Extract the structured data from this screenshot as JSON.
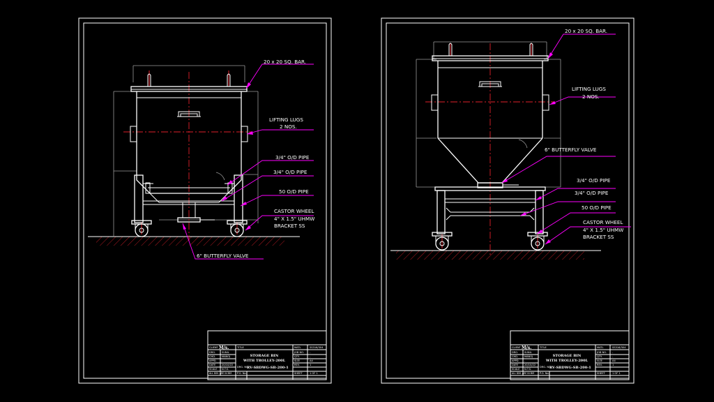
{
  "colors": {
    "background": "#000000",
    "lines": "#ffffff",
    "centerline": "#e0202a",
    "leader": "#ff00ff",
    "dimension": "#9a9a9a"
  },
  "sheets": [
    {
      "callouts": {
        "bar": "20 x 20 SQ. BAR.",
        "lugs_1": "LIFTING LUGS",
        "lugs_2": "2 NOS.",
        "pipe_a": "3/4\" O/D PIPE",
        "pipe_b": "3/4\" O/D PIPE",
        "pipe_c": "50 O/D PIPE",
        "castor_1": "CASTOR WHEEL",
        "castor_2": "4\" X 1.5\" UHMW",
        "castor_3": "BRACKET SS",
        "valve": "6\" BUTTERFLY VALVE"
      }
    },
    {
      "callouts": {
        "bar": "20 x 20 SQ. BAR.",
        "lugs_1": "LIFTING LUGS",
        "lugs_2": "2 NOS.",
        "valve": "6\" BUTTERFLY VALVE",
        "pipe_a": "3/4\" O/D PIPE",
        "pipe_b": "3/4\" O/D PIPE",
        "pipe_c": "50 O/D PIPE",
        "castor_1": "CASTOR WHEEL",
        "castor_2": "4\" X 1.5\" UHMW",
        "castor_3": "BRACKET SS"
      }
    }
  ],
  "title_block": {
    "client_label": "CLIENT",
    "client_value": "M/s.",
    "rows": [
      {
        "k": "DRG.",
        "v": "SUNIL"
      },
      {
        "k": "CHD.",
        "v": "MANOJ"
      },
      {
        "k": "APPD.",
        "v": "-"
      },
      {
        "k": "DATE",
        "v": "20/10/22"
      },
      {
        "k": "SCALE",
        "v": "N.T.S."
      },
      {
        "k": "ALL DIM. ARE IN MM",
        "v": ""
      }
    ],
    "title_label": "TITLE",
    "title_line1": "STORAGE BIN",
    "title_line2": "WITH TROLLEY-200L",
    "drg_no_label": "DRG. NO.",
    "drg_no": "RV-SBDWG-SB-200-1",
    "po_label": "P.O. No.",
    "right_rows": [
      {
        "k": "MATL",
        "v": "SS316/304"
      },
      {
        "k": "JOB NO.",
        "v": "-"
      },
      {
        "k": "QTY.",
        "v": "-"
      },
      {
        "k": "SIZE",
        "v": "A4"
      },
      {
        "k": "REV.",
        "v": "1"
      },
      {
        "k": "SHEET",
        "v": "1 OF 1"
      }
    ]
  }
}
